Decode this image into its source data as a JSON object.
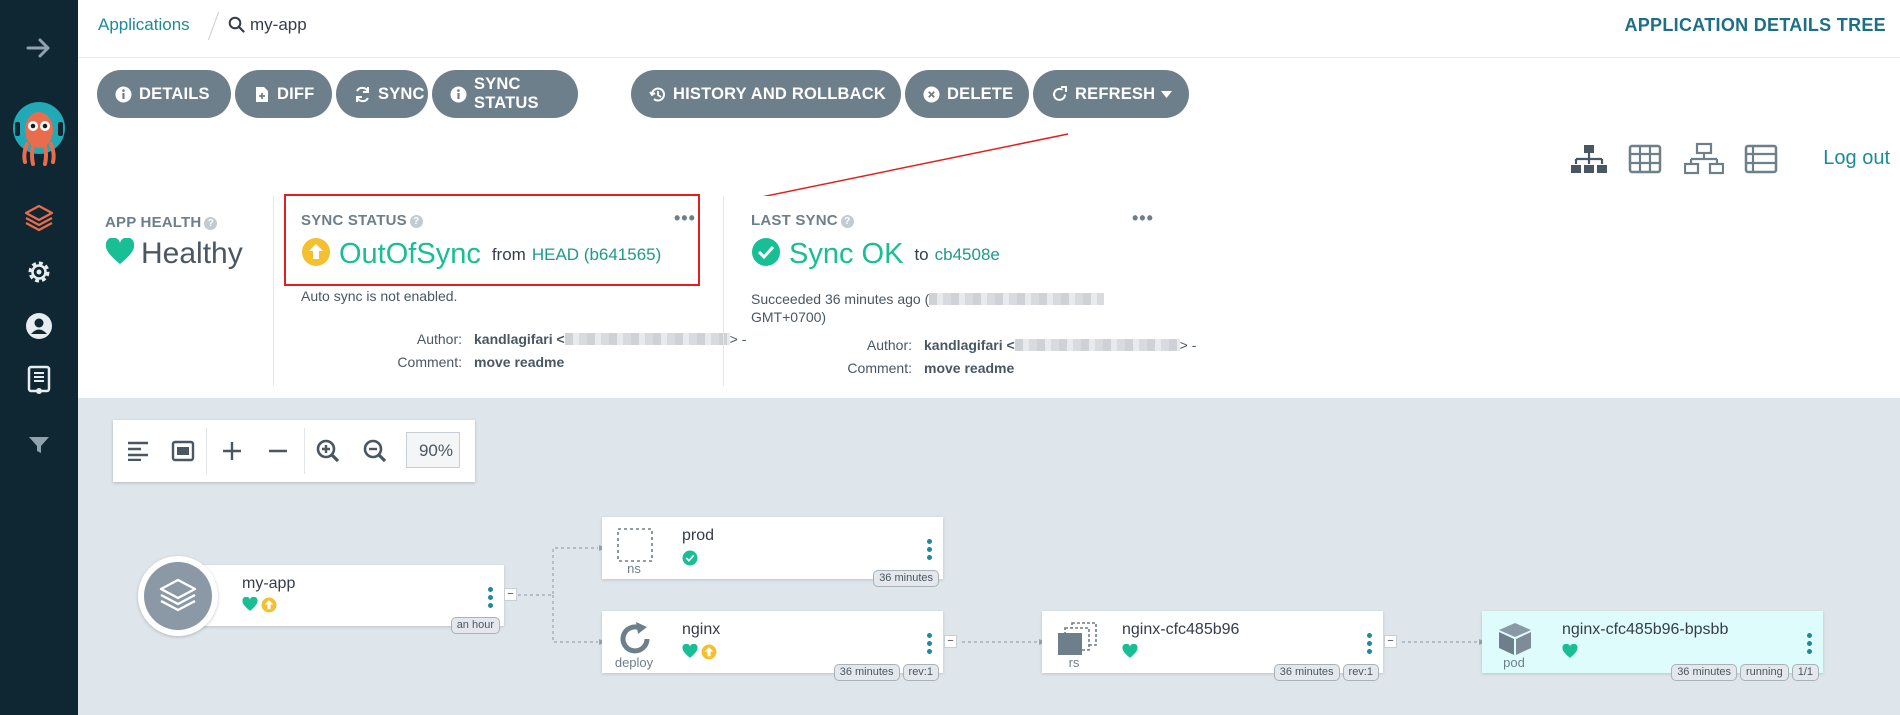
{
  "breadcrumb": {
    "applications": "Applications",
    "app": "my-app"
  },
  "page_title": "APPLICATION DETAILS TREE",
  "toolbar": {
    "details": "DETAILS",
    "diff": "DIFF",
    "sync": "SYNC",
    "sync_status": "SYNC STATUS",
    "history": "HISTORY AND ROLLBACK",
    "delete": "DELETE",
    "refresh": "REFRESH"
  },
  "view": {
    "logout": "Log out"
  },
  "app_health": {
    "label": "APP HEALTH",
    "value": "Healthy"
  },
  "sync_status": {
    "label": "SYNC STATUS",
    "value": "OutOfSync",
    "from_text": "from",
    "revision": "HEAD (b641565)",
    "auto_sync": "Auto sync is not enabled.",
    "author_label": "Author:",
    "author": "kandlagifari <",
    "author_tail": "> -",
    "comment_label": "Comment:",
    "comment": "move readme"
  },
  "last_sync": {
    "label": "LAST SYNC",
    "value": "Sync OK",
    "to_text": "to",
    "revision": "cb4508e",
    "succeeded": "Succeeded 36 minutes ago (",
    "timezone": "GMT+0700)",
    "author_label": "Author:",
    "author": "kandlagifari <",
    "author_tail": "> -",
    "comment_label": "Comment:",
    "comment": "move readme"
  },
  "zoom": {
    "value": "90%"
  },
  "nodes": {
    "app": {
      "name": "my-app",
      "age": "an hour"
    },
    "prod": {
      "name": "prod",
      "kind": "ns",
      "age": "36 minutes"
    },
    "nginx": {
      "name": "nginx",
      "kind": "deploy",
      "age": "36 minutes",
      "rev": "rev:1"
    },
    "rs": {
      "name": "nginx-cfc485b96",
      "kind": "rs",
      "age": "36 minutes",
      "rev": "rev:1"
    },
    "pod": {
      "name": "nginx-cfc485b96-bpsbb",
      "kind": "pod",
      "age": "36 minutes",
      "state": "running",
      "ready": "1/1"
    }
  },
  "colors": {
    "sidebar": "#0f2733",
    "accent": "#1d8a99",
    "healthy": "#18be94",
    "outofsync": "#f4c030",
    "button": "#6d7f8b",
    "annotation": "#e02020"
  }
}
